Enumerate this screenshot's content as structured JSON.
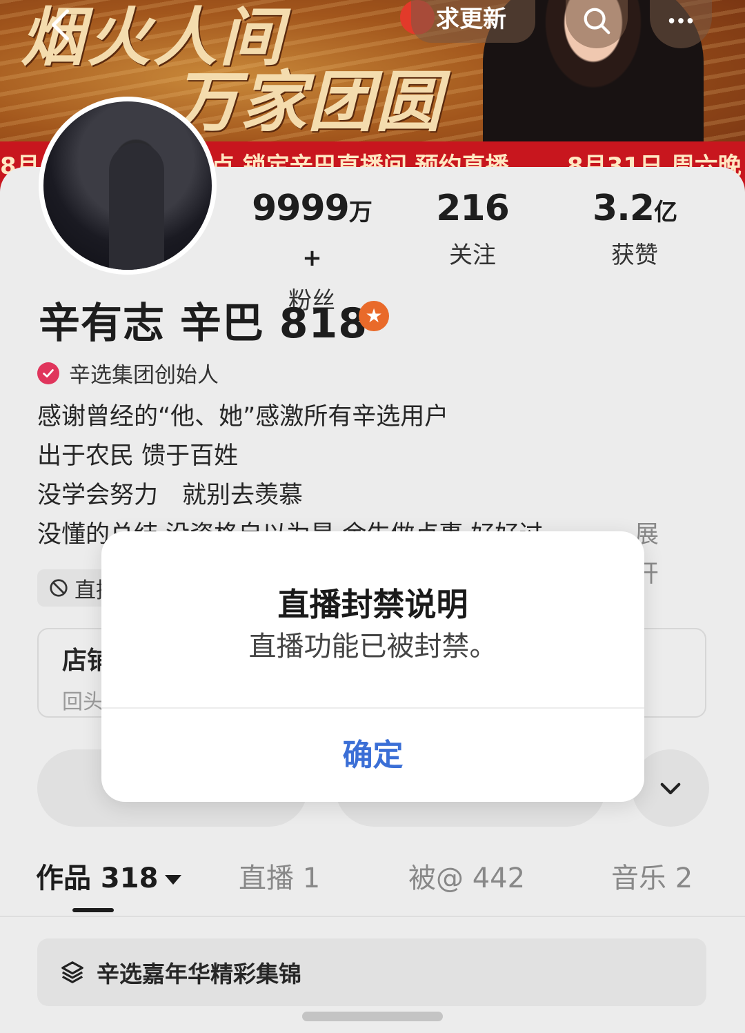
{
  "banner": {
    "title_line1": "烟火人间",
    "title_line2": "万家团圆",
    "ribbon_left": "8月",
    "ribbon_mid": "点 锁定辛巴直播间 预约直播",
    "ribbon_right": "8月31日 周六晚"
  },
  "topbar": {
    "back_icon": "chevron-left-icon",
    "update_label": "求更新",
    "search_icon": "search-icon",
    "more_icon": "more-dots-icon"
  },
  "profile": {
    "stats": [
      {
        "value": "9999",
        "unit": "万+",
        "label": "粉丝"
      },
      {
        "value": "216",
        "unit": "",
        "label": "关注"
      },
      {
        "value": "3.2",
        "unit": "亿",
        "label": "获赞"
      }
    ],
    "name": "辛有志 辛巴 818",
    "badge_icon": "star-badge-icon",
    "verification": "辛选集团创始人",
    "bio_lines": [
      "感谢曾经的“他、她”感激所有辛选用户",
      "出于农民 馈于百姓",
      "没学会努力　就别去羡慕",
      "没懂的总结 没资格自以为是 余生做点事 好好过"
    ],
    "expand_label": "展开",
    "live_chip": "直播",
    "shop_title": "店铺",
    "shop_subtitle": "回头"
  },
  "tabs": [
    {
      "label": "作品 318",
      "active": true
    },
    {
      "label": "直播 1",
      "active": false
    },
    {
      "label": "被@ 442",
      "active": false
    },
    {
      "label": "音乐 2",
      "active": false
    }
  ],
  "collection": {
    "icon": "layers-icon",
    "label": "辛选嘉年华精彩集锦"
  },
  "dialog": {
    "title": "直播封禁说明",
    "message": "直播功能已被封禁。",
    "confirm_label": "确定"
  },
  "colors": {
    "accent_blue": "#3b6fd6",
    "verify_pink": "#e0355c",
    "badge_orange": "#e96a2a",
    "ribbon_red": "#c8161e"
  }
}
